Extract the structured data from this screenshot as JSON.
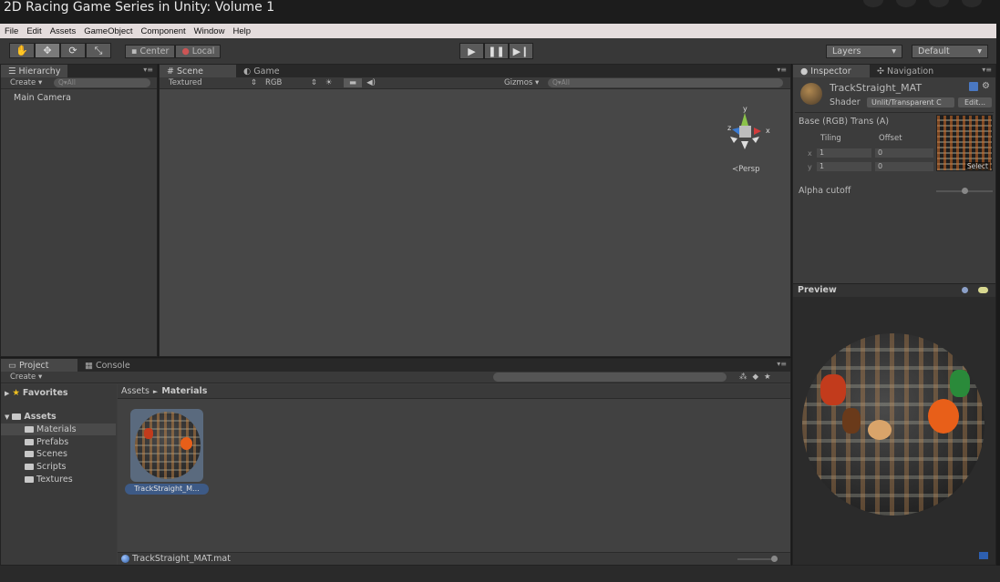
{
  "video": {
    "title": "2D Racing Game Series in Unity: Volume 1"
  },
  "menu": [
    "File",
    "Edit",
    "Assets",
    "GameObject",
    "Component",
    "Window",
    "Help"
  ],
  "toolbar": {
    "center_label": "Center",
    "local_label": "Local",
    "layers_label": "Layers",
    "layout_label": "Default"
  },
  "hierarchy": {
    "tab": "Hierarchy",
    "create": "Create ▾",
    "search_placeholder": "Q▾All",
    "items": [
      "Main Camera"
    ]
  },
  "scene": {
    "tab_scene": "Scene",
    "tab_game": "Game",
    "render_mode": "Textured",
    "color_mode": "RGB",
    "gizmos": "Gizmos ▾",
    "search_placeholder": "Q▾All",
    "persp": "≺Persp",
    "axis_y": "y",
    "axis_x": "x",
    "axis_z": "z"
  },
  "inspector": {
    "tab_inspector": "Inspector",
    "tab_navigation": "Navigation",
    "material_name": "TrackStraight_MAT",
    "shader_label": "Shader",
    "shader_value": "Unlit/Transparent C",
    "edit_button": "Edit...",
    "property_label": "Base (RGB) Trans (A)",
    "tiling_label": "Tiling",
    "offset_label": "Offset",
    "x_label": "x",
    "y_label": "y",
    "tiling_x": "1",
    "tiling_y": "1",
    "offset_x": "0",
    "offset_y": "0",
    "select_button": "Select",
    "alpha_cutoff_label": "Alpha cutoff",
    "alpha_cutoff_value": 0.5
  },
  "preview": {
    "title": "Preview"
  },
  "project": {
    "tab_project": "Project",
    "tab_console": "Console",
    "create": "Create ▾",
    "favorites": "Favorites",
    "assets": "Assets",
    "folders": [
      "Materials",
      "Prefabs",
      "Scenes",
      "Scripts",
      "Textures"
    ],
    "breadcrumb_root": "Assets",
    "breadcrumb_sep": "►",
    "breadcrumb_current": "Materials",
    "asset_tile_label": "TrackStraight_M...",
    "selected_file": "TrackStraight_MAT.mat"
  },
  "colors": {
    "menu_bg": "#e4dcdc",
    "panel_bg": "#3e3e3e",
    "scene_bg": "#474747",
    "selection": "#3d5a86",
    "gizmo_x": "#d23b3b",
    "gizmo_y": "#8bc34a",
    "gizmo_z": "#3b7bd2"
  }
}
